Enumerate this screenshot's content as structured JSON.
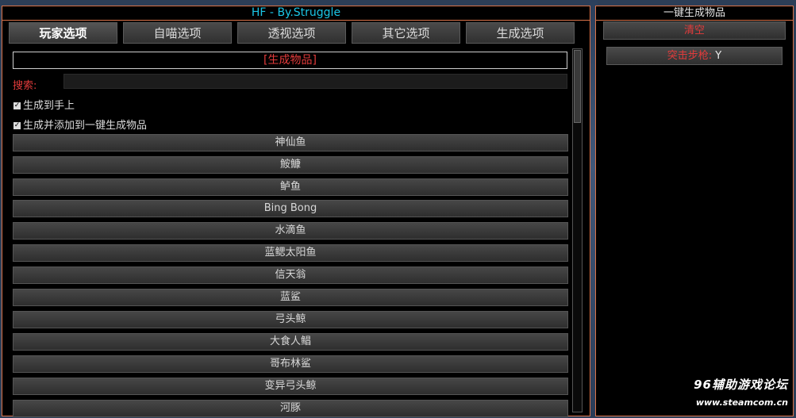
{
  "main_window": {
    "title": "HF - By.Struggle",
    "tabs": [
      {
        "label": "玩家选项"
      },
      {
        "label": "自喵选项"
      },
      {
        "label": "透视选项"
      },
      {
        "label": "其它选项"
      },
      {
        "label": "生成选项"
      }
    ],
    "section_header": "[生成物品]",
    "search": {
      "label": "搜索:",
      "value": "",
      "placeholder": ""
    },
    "checkboxes": [
      {
        "label": "生成到手上",
        "checked": true
      },
      {
        "label": "生成并添加到一键生成物品",
        "checked": true
      }
    ],
    "items": [
      {
        "label": "神仙鱼"
      },
      {
        "label": "鮟鱇"
      },
      {
        "label": "鲈鱼"
      },
      {
        "label": "Bing Bong"
      },
      {
        "label": "水滴鱼"
      },
      {
        "label": "蓝鳃太阳鱼"
      },
      {
        "label": "信天翁"
      },
      {
        "label": "蓝鲨"
      },
      {
        "label": "弓头鲸"
      },
      {
        "label": "大食人鲳"
      },
      {
        "label": "哥布林鲨"
      },
      {
        "label": "变异弓头鲸"
      },
      {
        "label": "河豚"
      }
    ]
  },
  "side_window": {
    "title": "一键生成物品",
    "clear_label": "清空",
    "jump_label": "突击步枪:",
    "jump_value": "Y"
  },
  "watermark": {
    "line1": "96辅助游戏论坛",
    "line2": "www.steamcom.cn"
  },
  "colors": {
    "title_cyan": "#1bc6e6",
    "accent_red": "#e23b3b",
    "border_orange": "#d9734a"
  }
}
